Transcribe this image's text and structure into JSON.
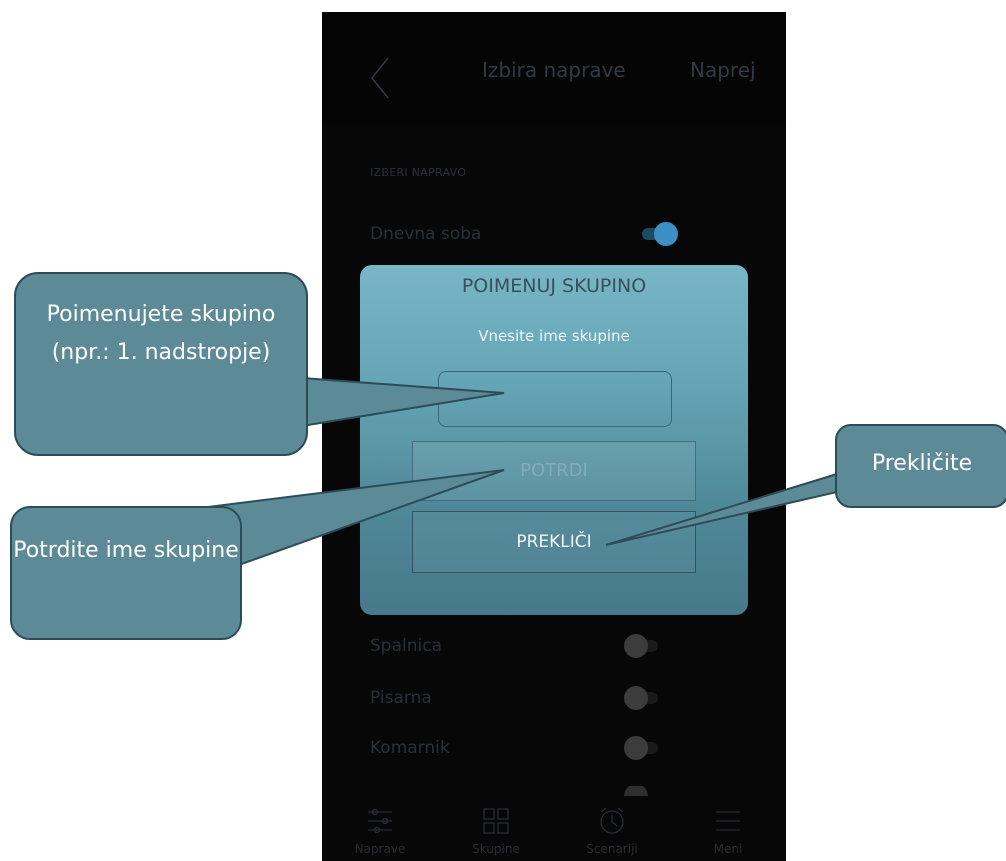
{
  "header": {
    "title": "Izbira naprave",
    "next_label": "Naprej"
  },
  "section_label": "IZBERI NAPRAVO",
  "devices": [
    {
      "label": "Dnevna soba",
      "on": true
    },
    {
      "label": "Spalnica",
      "on": false
    },
    {
      "label": "Pisarna",
      "on": false
    },
    {
      "label": "Komarnik",
      "on": false
    }
  ],
  "dialog": {
    "title": "POIMENUJ SKUPINO",
    "subtitle": "Vnesite ime skupine",
    "input_value": "",
    "confirm_label": "POTRDI",
    "cancel_label": "PREKLIČI"
  },
  "tabbar": [
    {
      "label": "Naprave",
      "icon": "sliders-icon"
    },
    {
      "label": "Skupine",
      "icon": "grid-icon"
    },
    {
      "label": "Scenariji",
      "icon": "alarm-clock-icon"
    },
    {
      "label": "Meni",
      "icon": "menu-icon"
    }
  ],
  "callouts": {
    "name_group": "Poimenujete skupino (npr.: 1. nadstropje)",
    "confirm_name": "Potrdite ime skupine",
    "cancel": "Prekličite"
  },
  "colors": {
    "accent": "#3b8fc4",
    "dialog_top": "#78b6c7",
    "dialog_bottom": "#47798a",
    "callout_fill": "#5d8a97",
    "callout_border": "#2c4c58"
  }
}
